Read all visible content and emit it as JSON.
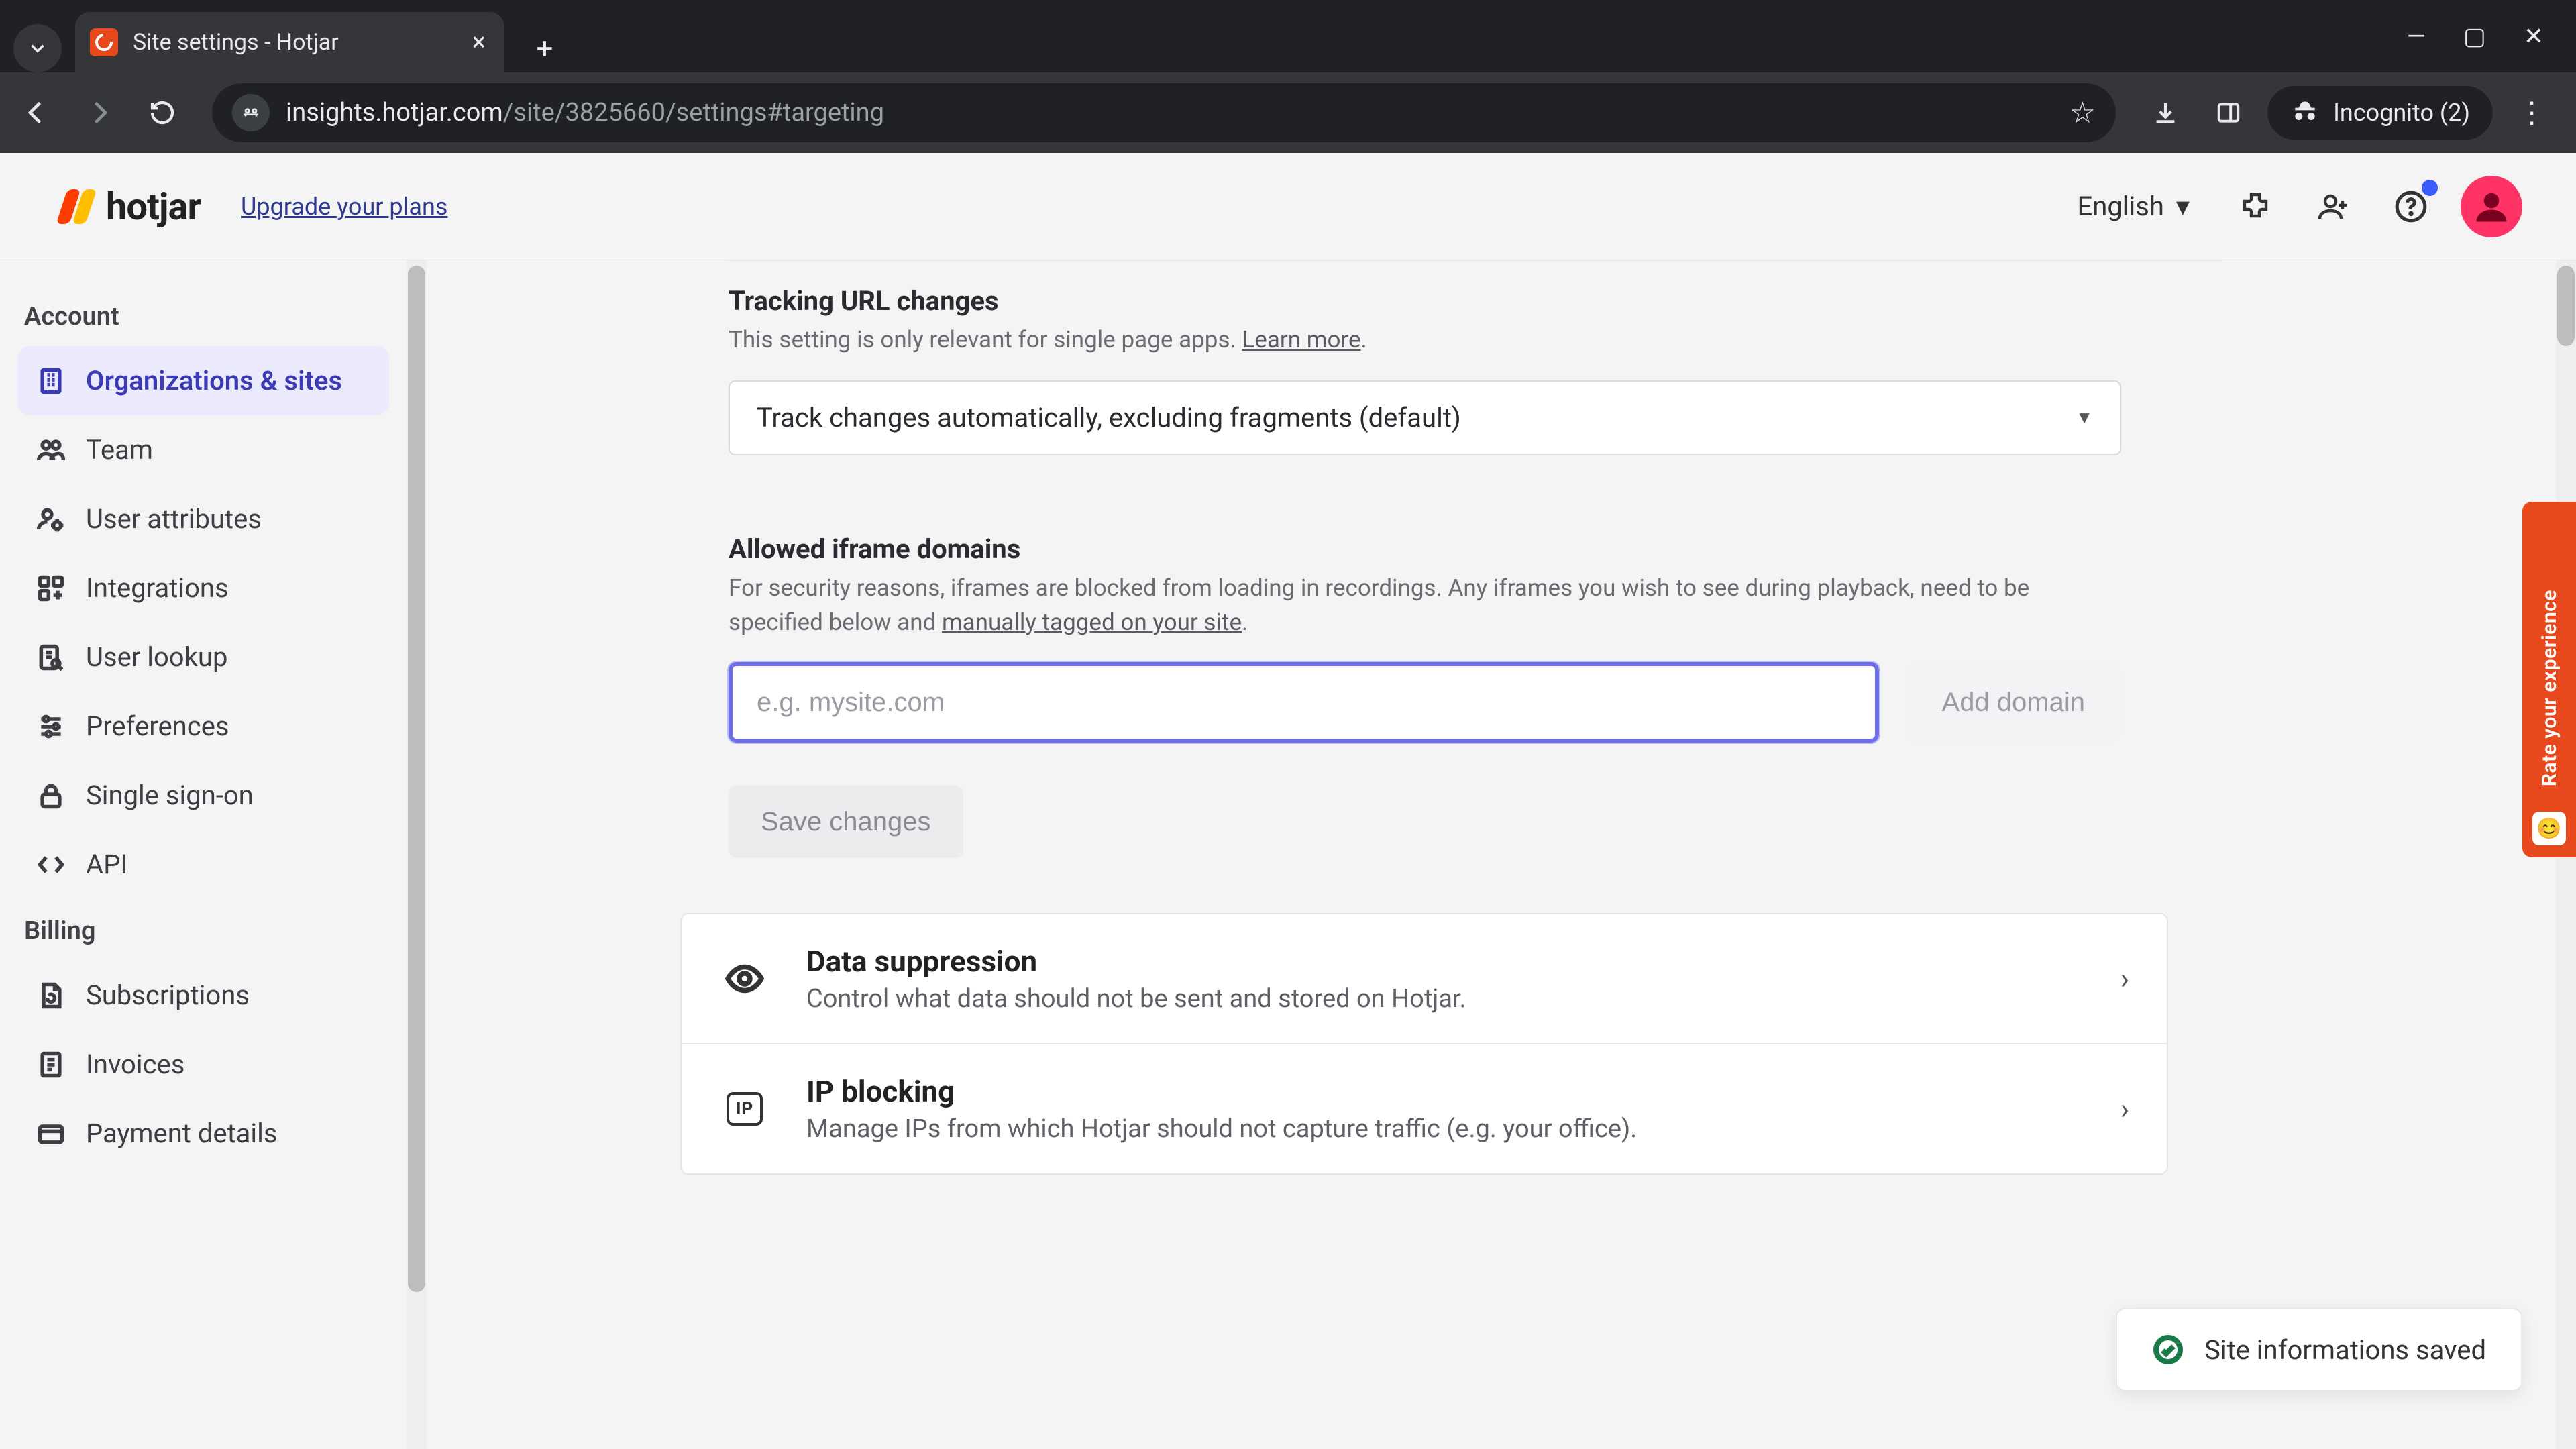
{
  "browser": {
    "tab_title": "Site settings - Hotjar",
    "url_host": "insights.hotjar.com",
    "url_path": "/site/3825660/settings#targeting",
    "incognito_label": "Incognito (2)"
  },
  "header": {
    "brand": "hotjar",
    "upgrade": "Upgrade your plans",
    "language": "English"
  },
  "sidebar": {
    "section_account": "Account",
    "section_billing": "Billing",
    "items_account": [
      {
        "key": "orgs",
        "label": "Organizations & sites",
        "active": true
      },
      {
        "key": "team",
        "label": "Team"
      },
      {
        "key": "user-attributes",
        "label": "User attributes"
      },
      {
        "key": "integrations",
        "label": "Integrations"
      },
      {
        "key": "user-lookup",
        "label": "User lookup"
      },
      {
        "key": "preferences",
        "label": "Preferences"
      },
      {
        "key": "sso",
        "label": "Single sign-on"
      },
      {
        "key": "api",
        "label": "API"
      }
    ],
    "items_billing": [
      {
        "key": "subscriptions",
        "label": "Subscriptions"
      },
      {
        "key": "invoices",
        "label": "Invoices"
      },
      {
        "key": "payment",
        "label": "Payment details"
      }
    ]
  },
  "settings": {
    "tracking": {
      "title": "Tracking URL changes",
      "desc": "This setting is only relevant for single page apps. ",
      "learn_more": "Learn more",
      "select_value": "Track changes automatically, excluding fragments (default)"
    },
    "iframes": {
      "title": "Allowed iframe domains",
      "desc_a": "For security reasons, iframes are blocked from loading in recordings. Any iframes you wish to see during playback, need to be specified below and ",
      "desc_link": "manually tagged on your site",
      "placeholder": "e.g. mysite.com",
      "add_btn": "Add domain"
    },
    "save_btn": "Save changes",
    "data_suppression": {
      "title": "Data suppression",
      "desc": "Control what data should not be sent and stored on Hotjar."
    },
    "ip_blocking": {
      "title": "IP blocking",
      "desc": "Manage IPs from which Hotjar should not capture traffic (e.g. your office).",
      "badge": "IP"
    }
  },
  "toast": {
    "msg": "Site informations saved"
  },
  "feedback": {
    "label": "Rate your experience"
  }
}
